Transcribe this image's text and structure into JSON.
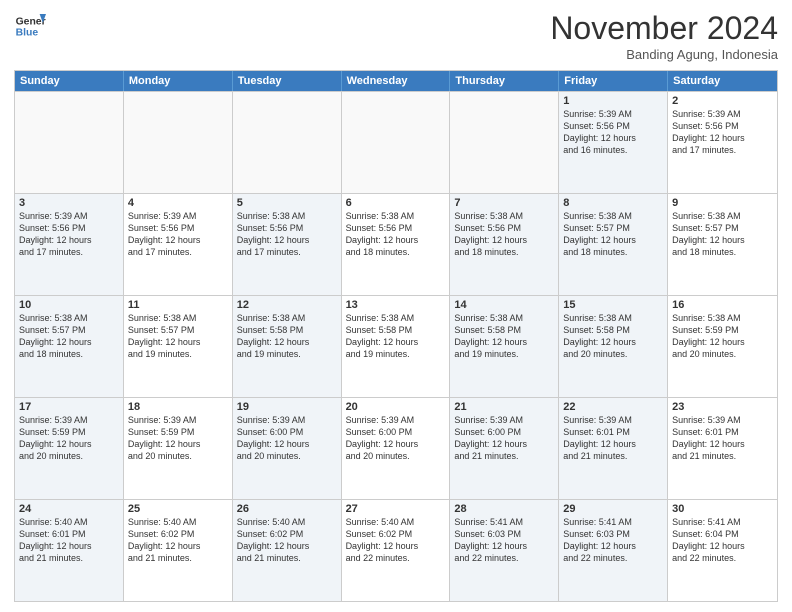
{
  "logo": {
    "line1": "General",
    "line2": "Blue"
  },
  "title": "November 2024",
  "location": "Banding Agung, Indonesia",
  "weekdays": [
    "Sunday",
    "Monday",
    "Tuesday",
    "Wednesday",
    "Thursday",
    "Friday",
    "Saturday"
  ],
  "rows": [
    [
      {
        "day": "",
        "info": "",
        "empty": true
      },
      {
        "day": "",
        "info": "",
        "empty": true
      },
      {
        "day": "",
        "info": "",
        "empty": true
      },
      {
        "day": "",
        "info": "",
        "empty": true
      },
      {
        "day": "",
        "info": "",
        "empty": true
      },
      {
        "day": "1",
        "info": "Sunrise: 5:39 AM\nSunset: 5:56 PM\nDaylight: 12 hours\nand 16 minutes.",
        "shaded": true
      },
      {
        "day": "2",
        "info": "Sunrise: 5:39 AM\nSunset: 5:56 PM\nDaylight: 12 hours\nand 17 minutes."
      }
    ],
    [
      {
        "day": "3",
        "info": "Sunrise: 5:39 AM\nSunset: 5:56 PM\nDaylight: 12 hours\nand 17 minutes.",
        "shaded": true
      },
      {
        "day": "4",
        "info": "Sunrise: 5:39 AM\nSunset: 5:56 PM\nDaylight: 12 hours\nand 17 minutes."
      },
      {
        "day": "5",
        "info": "Sunrise: 5:38 AM\nSunset: 5:56 PM\nDaylight: 12 hours\nand 17 minutes.",
        "shaded": true
      },
      {
        "day": "6",
        "info": "Sunrise: 5:38 AM\nSunset: 5:56 PM\nDaylight: 12 hours\nand 18 minutes."
      },
      {
        "day": "7",
        "info": "Sunrise: 5:38 AM\nSunset: 5:56 PM\nDaylight: 12 hours\nand 18 minutes.",
        "shaded": true
      },
      {
        "day": "8",
        "info": "Sunrise: 5:38 AM\nSunset: 5:57 PM\nDaylight: 12 hours\nand 18 minutes.",
        "shaded": true
      },
      {
        "day": "9",
        "info": "Sunrise: 5:38 AM\nSunset: 5:57 PM\nDaylight: 12 hours\nand 18 minutes."
      }
    ],
    [
      {
        "day": "10",
        "info": "Sunrise: 5:38 AM\nSunset: 5:57 PM\nDaylight: 12 hours\nand 18 minutes.",
        "shaded": true
      },
      {
        "day": "11",
        "info": "Sunrise: 5:38 AM\nSunset: 5:57 PM\nDaylight: 12 hours\nand 19 minutes."
      },
      {
        "day": "12",
        "info": "Sunrise: 5:38 AM\nSunset: 5:58 PM\nDaylight: 12 hours\nand 19 minutes.",
        "shaded": true
      },
      {
        "day": "13",
        "info": "Sunrise: 5:38 AM\nSunset: 5:58 PM\nDaylight: 12 hours\nand 19 minutes."
      },
      {
        "day": "14",
        "info": "Sunrise: 5:38 AM\nSunset: 5:58 PM\nDaylight: 12 hours\nand 19 minutes.",
        "shaded": true
      },
      {
        "day": "15",
        "info": "Sunrise: 5:38 AM\nSunset: 5:58 PM\nDaylight: 12 hours\nand 20 minutes.",
        "shaded": true
      },
      {
        "day": "16",
        "info": "Sunrise: 5:38 AM\nSunset: 5:59 PM\nDaylight: 12 hours\nand 20 minutes."
      }
    ],
    [
      {
        "day": "17",
        "info": "Sunrise: 5:39 AM\nSunset: 5:59 PM\nDaylight: 12 hours\nand 20 minutes.",
        "shaded": true
      },
      {
        "day": "18",
        "info": "Sunrise: 5:39 AM\nSunset: 5:59 PM\nDaylight: 12 hours\nand 20 minutes."
      },
      {
        "day": "19",
        "info": "Sunrise: 5:39 AM\nSunset: 6:00 PM\nDaylight: 12 hours\nand 20 minutes.",
        "shaded": true
      },
      {
        "day": "20",
        "info": "Sunrise: 5:39 AM\nSunset: 6:00 PM\nDaylight: 12 hours\nand 20 minutes."
      },
      {
        "day": "21",
        "info": "Sunrise: 5:39 AM\nSunset: 6:00 PM\nDaylight: 12 hours\nand 21 minutes.",
        "shaded": true
      },
      {
        "day": "22",
        "info": "Sunrise: 5:39 AM\nSunset: 6:01 PM\nDaylight: 12 hours\nand 21 minutes.",
        "shaded": true
      },
      {
        "day": "23",
        "info": "Sunrise: 5:39 AM\nSunset: 6:01 PM\nDaylight: 12 hours\nand 21 minutes."
      }
    ],
    [
      {
        "day": "24",
        "info": "Sunrise: 5:40 AM\nSunset: 6:01 PM\nDaylight: 12 hours\nand 21 minutes.",
        "shaded": true
      },
      {
        "day": "25",
        "info": "Sunrise: 5:40 AM\nSunset: 6:02 PM\nDaylight: 12 hours\nand 21 minutes."
      },
      {
        "day": "26",
        "info": "Sunrise: 5:40 AM\nSunset: 6:02 PM\nDaylight: 12 hours\nand 21 minutes.",
        "shaded": true
      },
      {
        "day": "27",
        "info": "Sunrise: 5:40 AM\nSunset: 6:02 PM\nDaylight: 12 hours\nand 22 minutes."
      },
      {
        "day": "28",
        "info": "Sunrise: 5:41 AM\nSunset: 6:03 PM\nDaylight: 12 hours\nand 22 minutes.",
        "shaded": true
      },
      {
        "day": "29",
        "info": "Sunrise: 5:41 AM\nSunset: 6:03 PM\nDaylight: 12 hours\nand 22 minutes.",
        "shaded": true
      },
      {
        "day": "30",
        "info": "Sunrise: 5:41 AM\nSunset: 6:04 PM\nDaylight: 12 hours\nand 22 minutes."
      }
    ]
  ]
}
